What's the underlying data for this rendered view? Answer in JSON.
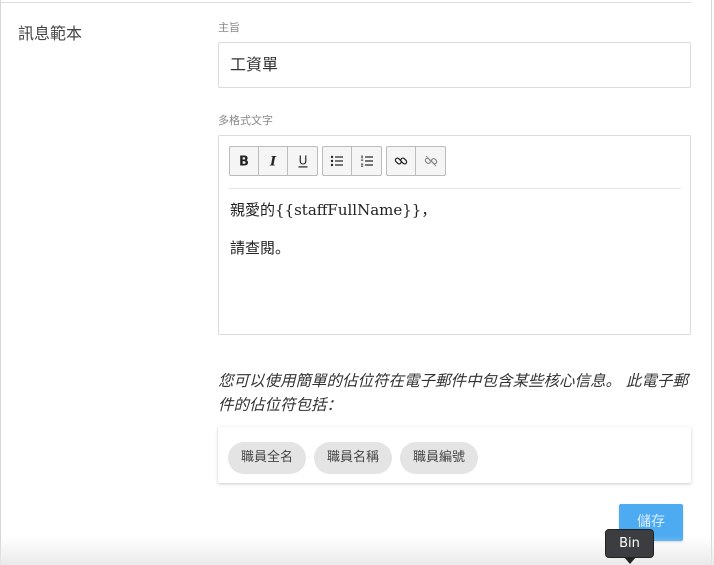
{
  "section_label": "訊息範本",
  "subject": {
    "label": "主旨",
    "value": "工資單"
  },
  "richtext": {
    "label": "多格式文字",
    "toolbar": [
      {
        "group": "format",
        "buttons": [
          "bold-icon",
          "italic-icon",
          "underline-icon"
        ]
      },
      {
        "group": "list",
        "buttons": [
          "bullet-list-icon",
          "numbered-list-icon"
        ]
      },
      {
        "group": "link",
        "buttons": [
          "link-icon",
          "unlink-icon"
        ]
      }
    ],
    "paragraphs": [
      "親愛的{{staffFullName}}，",
      "請查閱。"
    ]
  },
  "hint_text": "您可以使用簡單的佔位符在電子郵件中包含某些核心信息。 此電子郵件的佔位符包括：",
  "placeholders": [
    "職員全名",
    "職員名稱",
    "職員編號"
  ],
  "save_label": "儲存",
  "tooltip": "Bin",
  "colors": {
    "accent": "#4dabf1",
    "chip_bg": "#e4e4e4",
    "tooltip_bg": "#3b3d40"
  }
}
